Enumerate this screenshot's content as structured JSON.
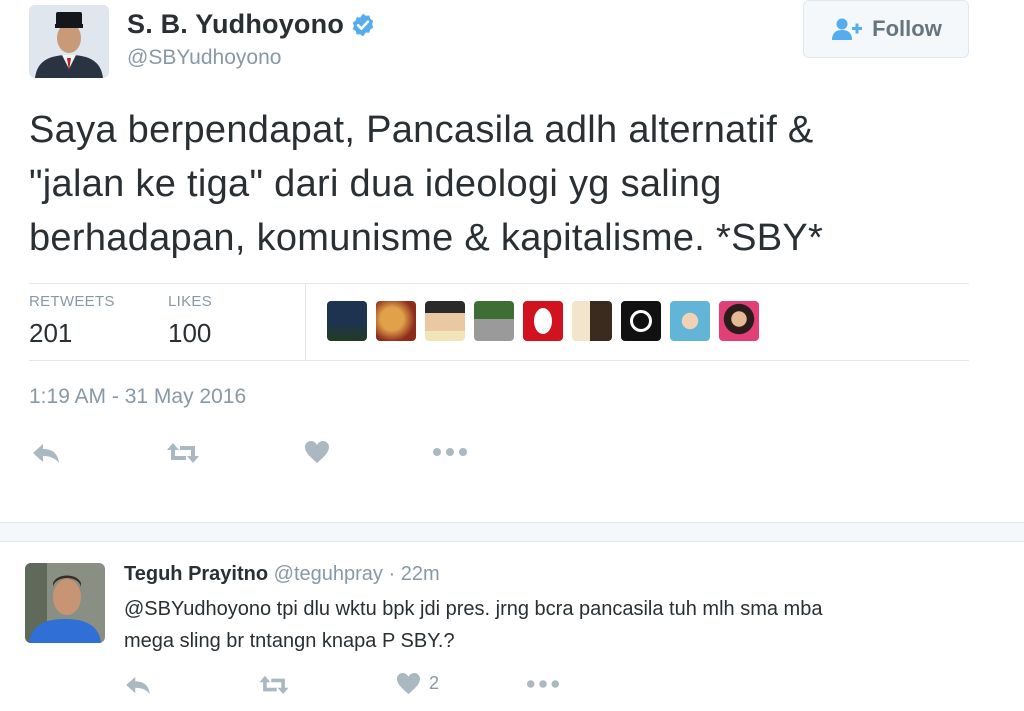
{
  "tweet": {
    "author_name": "S. B. Yudhoyono",
    "author_handle": "@SBYudhoyono",
    "verified_icon": "verified-badge-icon",
    "follow_label": "Follow",
    "text_lines": [
      "Saya berpendapat, Pancasila adlh alternatif &",
      "\"jalan ke tiga\" dari dua ideologi yg saling",
      "berhadapan, komunisme & kapitalisme. *SBY*"
    ],
    "stats": {
      "retweets_label": "RETWEETS",
      "retweets_value": "201",
      "likes_label": "LIKES",
      "likes_value": "100"
    },
    "liker_avatars": [
      "liker-avatar-1",
      "liker-avatar-2",
      "liker-avatar-3",
      "liker-avatar-4",
      "liker-avatar-5",
      "liker-avatar-6",
      "liker-avatar-7",
      "liker-avatar-8",
      "liker-avatar-9"
    ],
    "timestamp": "1:19 AM - 31 May 2016",
    "actions": [
      "reply-icon",
      "retweet-icon",
      "like-icon",
      "more-icon"
    ]
  },
  "reply": {
    "author_name": "Teguh Prayitno",
    "author_handle": "@teguhpray",
    "time": "· 22m",
    "text_lines": [
      "@SBYudhoyono tpi dlu wktu bpk jdi pres. jrng bcra pancasila tuh mlh sma mba",
      "mega sling br tntangn knapa P SBY.?"
    ],
    "like_count": "2",
    "actions": [
      "reply-icon",
      "retweet-icon",
      "like-icon",
      "more-icon"
    ]
  },
  "colors": {
    "text": "#292f33",
    "muted": "#8899a6",
    "verified": "#55acee",
    "icon": "#aab8c2",
    "border": "#e1e8ed"
  }
}
